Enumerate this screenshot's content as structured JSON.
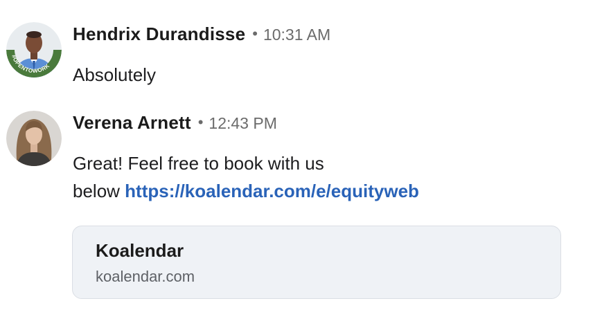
{
  "messages": [
    {
      "sender": "Hendrix Durandisse",
      "time": "10:31 AM",
      "avatar": "avatar-man-opentowork-frame",
      "avatar_badge_text": "#OPENTOWORK",
      "text": "Absolutely"
    },
    {
      "sender": "Verena Arnett",
      "time": "12:43 PM",
      "avatar": "avatar-woman",
      "text_line1": "Great! Feel free to book with us",
      "text_line2_prefix": "below ",
      "link_text": "https://koalendar.com/e/equityweb",
      "preview": {
        "title": "Koalendar",
        "domain": "koalendar.com"
      }
    }
  ],
  "separator": "•",
  "colors": {
    "link": "#2a63b8",
    "timestamp": "#6b6b6b",
    "card_bg": "#eff2f6",
    "card_border": "#dadee4",
    "opentowork_ring": "#4a7a3c"
  }
}
